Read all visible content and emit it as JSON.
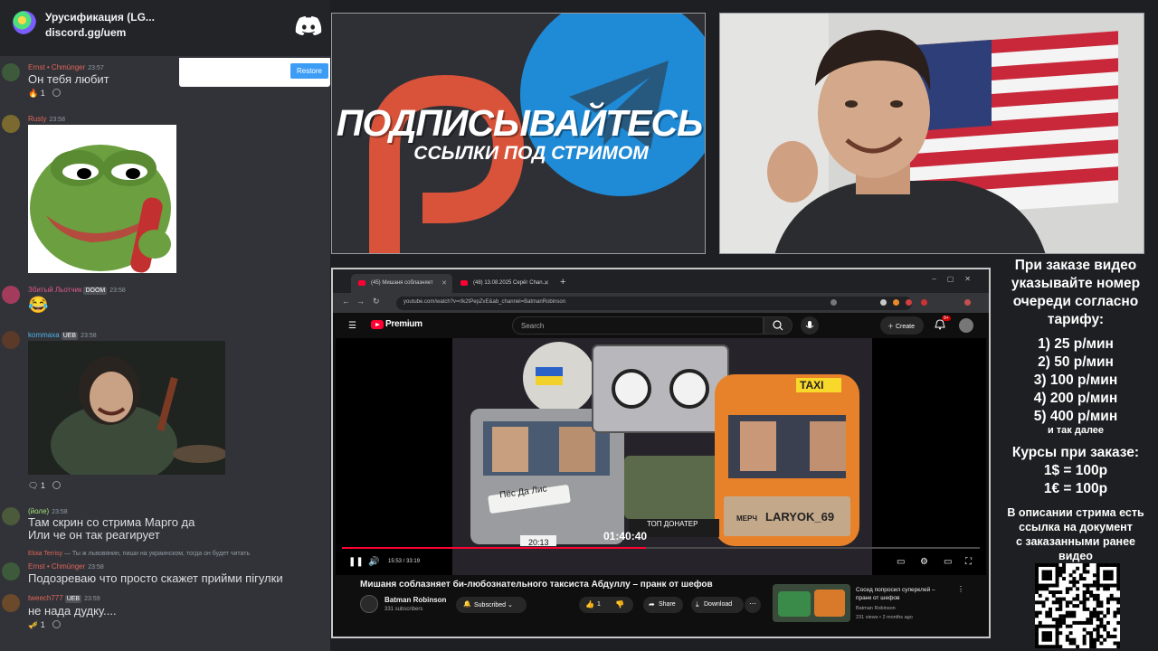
{
  "discord": {
    "server_name": "Урусификация (LG...",
    "server_link": "discord.gg/uem",
    "restore_label": "Restore",
    "messages": [
      {
        "user": "Ernst • Chmünger",
        "time": "23:57",
        "text": "Он тебя любит",
        "reaction": "1",
        "user_color": "#e0665a"
      },
      {
        "user": "Rusty",
        "time": "23:58",
        "user_color": "#e0665a"
      },
      {
        "user": "Збитый Льотчик",
        "badge": "DOOM",
        "time": "23:58",
        "user_color": "#e05a8a"
      },
      {
        "user": "kommaxa",
        "badge": "UEB",
        "time": "23:58",
        "reaction": "1",
        "user_color": "#4fb3e8"
      },
      {
        "user": "(йоле)",
        "time": "23:58",
        "text_lines": [
          "Там скрин со стрима Марго да",
          "Или че он так реагирует"
        ],
        "user_color": "#a4e07a"
      },
      {
        "reply": "Ты ж львовянин, пиши на украинском, тогда он будет читать",
        "reply_user": "Eloia Terrisy",
        "user": "Ernst • Chmünger",
        "time": "23:58",
        "text": "Подозреваю что просто скажет прийми пігулки",
        "user_color": "#e0665a"
      },
      {
        "user": "tweech777",
        "badge": "UEB",
        "time": "23:59",
        "text": "не нада дудку....",
        "reaction": "1",
        "user_color": "#e0665a"
      }
    ]
  },
  "banner": {
    "title": "ПОДПИСЫВАЙТЕСЬ",
    "subtitle": "ССЫЛКИ ПОД СТРИМОМ"
  },
  "browser": {
    "tabs": [
      {
        "label": "(45) Мишаня соблазняет"
      },
      {
        "label": "(48) 13.08.2025 Серёг Chan..."
      }
    ],
    "url": "youtube.com/watch?v=rIk2tPepZvE&ab_channel=BatmanRobinson"
  },
  "youtube": {
    "logo_text": "Premium",
    "search_placeholder": "Search",
    "create_label": "Create",
    "notif_count": "9+",
    "player": {
      "timecode": "15:53 / 33:19",
      "progress": 0.477,
      "thumb_time": "20:13",
      "thumb_big_time": "01:40:40",
      "thumb_sign": "Пёс Да Лис",
      "thumb_taxi": "TAXI",
      "thumb_merch": "МЕРЧ",
      "thumb_handle": "LARYOK_69",
      "thumb_top": "ТОП ДОНАТЕР"
    },
    "video_title": "Мишаня соблазняет би-любознательного таксиста Абдуллу – пранк от шефов",
    "channel_name": "Batman Robinson",
    "channel_subs": "331 subscribers",
    "subscribed_label": "Subscribed",
    "like_count": "1",
    "share_label": "Share",
    "download_label": "Download",
    "recommended": {
      "title": "Сосед попросил суперклей – пранк от шефов",
      "channel": "Batman Robinson",
      "meta": "231 views • 2 months ago"
    }
  },
  "info_panel": {
    "heading_lines": [
      "При заказе видео",
      "указывайте номер",
      "очереди согласно",
      "тарифу:"
    ],
    "tariffs": [
      "1) 25 р/мин",
      "2) 50 р/мин",
      "3) 100 р/мин",
      "4) 200 р/мин",
      "5) 400 р/мин"
    ],
    "etc": "и так далее",
    "rates_heading": "Курсы при заказе:",
    "rates": [
      "1$ = 100р",
      "1€ = 100р"
    ],
    "note_lines": [
      "В описании стрима есть",
      "ссылка на документ",
      "с заказанными ранее",
      "видео"
    ]
  },
  "colors": {
    "discord_bg": "#313338",
    "youtube_red": "#ff0033",
    "restore_blue": "#3d9df5"
  }
}
